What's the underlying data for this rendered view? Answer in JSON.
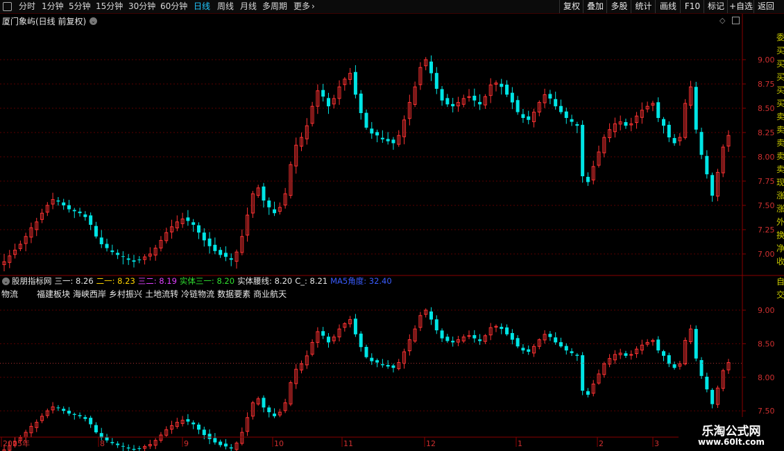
{
  "toolbar": {
    "periods": [
      {
        "label": "分时",
        "active": false
      },
      {
        "label": "1分钟",
        "active": false
      },
      {
        "label": "5分钟",
        "active": false
      },
      {
        "label": "15分钟",
        "active": false
      },
      {
        "label": "30分钟",
        "active": false
      },
      {
        "label": "60分钟",
        "active": false
      },
      {
        "label": "日线",
        "active": true
      },
      {
        "label": "周线",
        "active": false
      },
      {
        "label": "月线",
        "active": false
      },
      {
        "label": "多周期",
        "active": false
      },
      {
        "label": "更多",
        "active": false
      }
    ],
    "more_arrow": "›",
    "right_buttons": [
      "复权",
      "叠加",
      "多股",
      "统计",
      "画线",
      "F10",
      "标记",
      "+自选",
      "返回"
    ]
  },
  "main_panel": {
    "title": "厦门象屿(日线 前复权)",
    "y_ticks": [
      "9.00",
      "8.75",
      "8.50",
      "8.25",
      "8.00",
      "7.75",
      "7.50",
      "7.25",
      "7.00"
    ],
    "right_side_chars": [
      "委",
      "买",
      "买",
      "买",
      "买",
      "买",
      "卖",
      "卖",
      "卖",
      "卖",
      "卖",
      "现",
      "涨",
      "涨",
      "外",
      "换",
      "净",
      "收"
    ]
  },
  "indicator_panel": {
    "items": [
      {
        "text": "股朋指标网",
        "color": "#e6e6e6"
      },
      {
        "text": "三一: 8.26",
        "color": "#e6e6e6"
      },
      {
        "text": "二一: 8.23",
        "color": "#ffd400"
      },
      {
        "text": "三二: 8.19",
        "color": "#e040ff"
      },
      {
        "text": "实体三一: 8.20",
        "color": "#30e030"
      },
      {
        "text": "实体腰线: 8.20",
        "color": "#e6e6e6"
      },
      {
        "text": "C_: 8.21",
        "color": "#e6e6e6"
      },
      {
        "text": "MA5角度: 32.40",
        "color": "#3a5cff"
      }
    ],
    "tags": [
      "物流",
      "福建板块",
      "海峡西岸",
      "乡村振兴",
      "土地流转",
      "冷链物流",
      "数据要素",
      "商业航天"
    ],
    "y_ticks": [
      "9.00",
      "8.50",
      "8.00",
      "7.50"
    ],
    "right_side_chars": [
      "自",
      "交"
    ]
  },
  "date_axis": {
    "labels": [
      "2025年",
      "8",
      "9",
      "10",
      "11",
      "12",
      "1",
      "2",
      "3"
    ]
  },
  "watermark": {
    "title": "乐淘公式网",
    "url": "www.60lt.com"
  },
  "colors": {
    "up": "#ff3232",
    "down": "#00e5e5",
    "active_tab": "#20c8ff",
    "grid": "#5a0000"
  },
  "chart_data": {
    "type": "candlestick",
    "title": "厦门象屿(日线 前复权)",
    "ylim": [
      6.8,
      9.3
    ],
    "x_labels": [
      "2025年",
      "8",
      "9",
      "10",
      "11",
      "12",
      "1",
      "2",
      "3"
    ],
    "close_series": [
      6.92,
      6.98,
      7.04,
      7.1,
      7.18,
      7.27,
      7.33,
      7.42,
      7.5,
      7.56,
      7.54,
      7.5,
      7.46,
      7.44,
      7.42,
      7.38,
      7.3,
      7.18,
      7.1,
      7.06,
      7.02,
      6.99,
      6.97,
      6.94,
      6.92,
      6.94,
      6.97,
      7.0,
      7.06,
      7.14,
      7.22,
      7.28,
      7.33,
      7.36,
      7.34,
      7.3,
      7.22,
      7.14,
      7.08,
      7.03,
      6.99,
      6.97,
      6.94,
      7.02,
      7.18,
      7.4,
      7.62,
      7.68,
      7.55,
      7.48,
      7.42,
      7.48,
      7.62,
      7.92,
      8.12,
      8.2,
      8.32,
      8.52,
      8.68,
      8.62,
      8.52,
      8.6,
      8.72,
      8.8,
      8.86,
      8.64,
      8.45,
      8.3,
      8.24,
      8.22,
      8.18,
      8.16,
      8.14,
      8.22,
      8.38,
      8.56,
      8.72,
      8.92,
      9.0,
      8.86,
      8.7,
      8.58,
      8.54,
      8.52,
      8.56,
      8.6,
      8.62,
      8.58,
      8.54,
      8.62,
      8.74,
      8.76,
      8.72,
      8.64,
      8.56,
      8.46,
      8.4,
      8.38,
      8.46,
      8.56,
      8.64,
      8.6,
      8.52,
      8.46,
      8.4,
      8.36,
      8.32,
      7.8,
      7.74,
      7.9,
      8.05,
      8.2,
      8.28,
      8.34,
      8.36,
      8.32,
      8.34,
      8.42,
      8.48,
      8.52,
      8.55,
      8.4,
      8.32,
      8.2,
      8.14,
      8.2,
      8.55,
      8.72,
      8.28,
      8.02,
      7.82,
      7.6,
      7.84,
      8.1,
      8.22
    ]
  }
}
